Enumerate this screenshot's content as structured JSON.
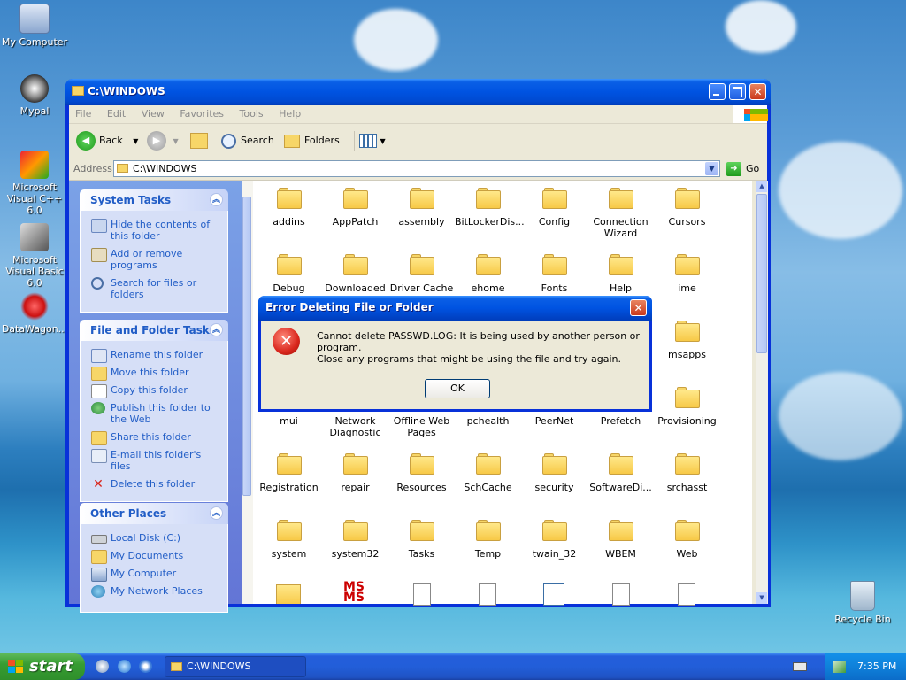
{
  "desktop": {
    "icons": [
      {
        "label": "My Computer"
      },
      {
        "label": "Mypal"
      },
      {
        "label": "Microsoft Visual C++ 6.0"
      },
      {
        "label": "Microsoft Visual Basic 6.0"
      },
      {
        "label": "DataWagon..."
      },
      {
        "label": "Recycle Bin"
      }
    ]
  },
  "window": {
    "title": "C:\\WINDOWS",
    "menu": [
      "File",
      "Edit",
      "View",
      "Favorites",
      "Tools",
      "Help"
    ],
    "toolbar": {
      "back": "Back",
      "search": "Search",
      "folders": "Folders"
    },
    "address": {
      "label": "Address",
      "value": "C:\\WINDOWS",
      "go": "Go"
    }
  },
  "tasks": {
    "system": {
      "title": "System Tasks",
      "items": [
        "Hide the contents of this folder",
        "Add or remove programs",
        "Search for files or folders"
      ]
    },
    "file_folder": {
      "title": "File and Folder Tasks",
      "items": [
        "Rename this folder",
        "Move this folder",
        "Copy this folder",
        "Publish this folder to the Web",
        "Share this folder",
        "E-mail this folder's files",
        "Delete this folder"
      ]
    },
    "other": {
      "title": "Other Places",
      "items": [
        "Local Disk (C:)",
        "My Documents",
        "My Computer",
        "My Network Places"
      ]
    }
  },
  "files": {
    "row1": [
      "addins",
      "AppPatch",
      "assembly",
      "BitLockerDis...",
      "Config",
      "Connection Wizard",
      "Cursors"
    ],
    "row2": [
      "Debug",
      "Downloaded",
      "Driver Cache",
      "ehome",
      "Fonts",
      "Help",
      "ime"
    ],
    "row3": [
      "msapps"
    ],
    "row4": [
      "mui",
      "Network Diagnostic",
      "Offline Web Pages",
      "pchealth",
      "PeerNet",
      "Prefetch",
      "Provisioning"
    ],
    "row5": [
      "Registration",
      "repair",
      "Resources",
      "SchCache",
      "security",
      "SoftwareDi...",
      "srchasst"
    ],
    "row6": [
      "system",
      "system32",
      "Tasks",
      "Temp",
      "twain_32",
      "WBEM",
      "Web"
    ]
  },
  "dialog": {
    "title": "Error Deleting File or Folder",
    "message": "Cannot delete PASSWD.LOG: It is being used by another person or program.",
    "hint": "Close any programs that might be using the file and try again.",
    "ok": "OK"
  },
  "taskbar": {
    "start": "start",
    "window_button": "C:\\WINDOWS",
    "clock": "7:35 PM"
  },
  "colors": {
    "titlebar": "#0053e1",
    "link": "#215dc6",
    "taskbar": "#245edb",
    "start": "#379d32",
    "folder": "#f7c947",
    "error": "#d9261c"
  }
}
